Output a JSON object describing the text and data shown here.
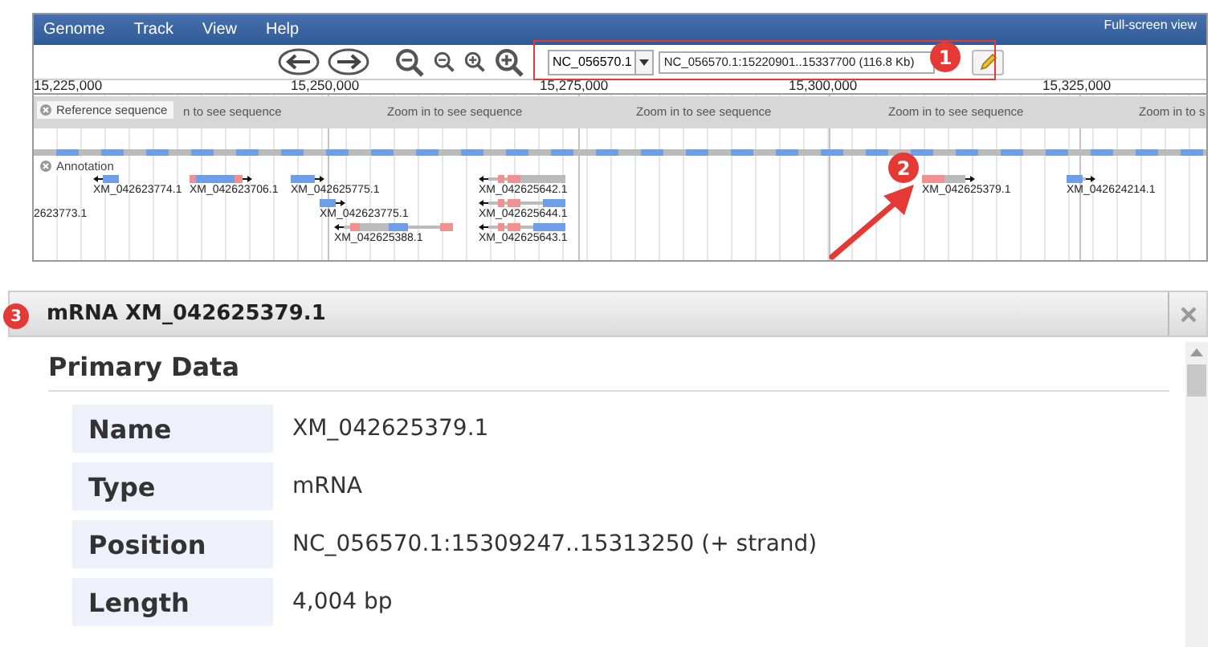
{
  "menu": [
    {
      "label": "Genome"
    },
    {
      "label": "Track"
    },
    {
      "label": "View"
    },
    {
      "label": "Help"
    }
  ],
  "fullscreen_link": "Full-screen view",
  "locator": {
    "sequence": "NC_056570.1",
    "location": "NC_056570.1:15220901..15337700 (116.8 Kb)"
  },
  "ruler": [
    "15,225,000",
    "15,250,000",
    "15,275,000",
    "15,300,000",
    "15,325,000"
  ],
  "reference_track": {
    "label": "Reference sequence",
    "placeholders": [
      "n to see sequence",
      "Zoom in to see sequence",
      "Zoom in to see sequence",
      "Zoom in to see sequence",
      "Zoom in to s"
    ]
  },
  "annotation_track": {
    "label": "Annotation",
    "features": [
      {
        "name": "XM_042623774.1",
        "kind": "transcript",
        "reverse_strand": true
      },
      {
        "name": "XM_042623706.1",
        "kind": "transcript",
        "reverse_strand": false
      },
      {
        "name": "XM_042625775.1",
        "kind": "transcript",
        "reverse_strand": false
      },
      {
        "name": "2623773.1",
        "kind": "label"
      },
      {
        "name": "XM_042623775.1",
        "kind": "transcript",
        "reverse_strand": false
      },
      {
        "name": "XM_042625388.1",
        "kind": "transcript",
        "reverse_strand": true
      },
      {
        "name": "XM_042625642.1",
        "kind": "transcript",
        "reverse_strand": true
      },
      {
        "name": "XM_042625644.1",
        "kind": "transcript",
        "reverse_strand": true
      },
      {
        "name": "XM_042625643.1",
        "kind": "transcript",
        "reverse_strand": true
      },
      {
        "name": "XM_042625379.1",
        "kind": "transcript",
        "reverse_strand": false
      },
      {
        "name": "XM_042624214.1",
        "kind": "transcript",
        "reverse_strand": false
      }
    ]
  },
  "callouts": [
    "1",
    "2",
    "3"
  ],
  "detail": {
    "title": "mRNA XM_042625379.1",
    "section": "Primary Data",
    "fields": [
      {
        "label": "Name",
        "value": "XM_042625379.1"
      },
      {
        "label": "Type",
        "value": "mRNA"
      },
      {
        "label": "Position",
        "value": "NC_056570.1:15309247..15313250 (+ strand)"
      },
      {
        "label": "Length",
        "value": "4,004 bp"
      }
    ]
  }
}
